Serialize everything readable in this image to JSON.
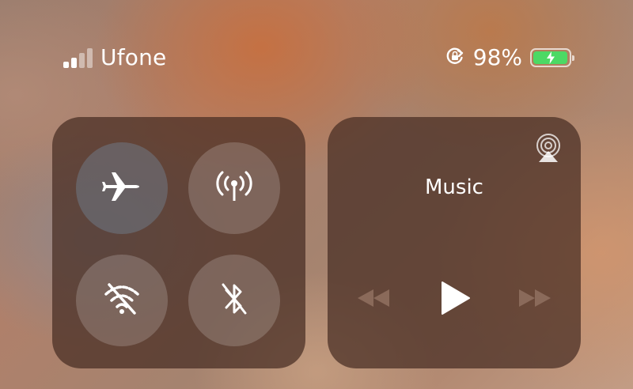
{
  "status_bar": {
    "carrier": "Ufone",
    "battery_percent": "98%",
    "battery_level": 0.98,
    "icons": [
      "signal-icon",
      "orientation-lock-icon",
      "battery-charging-icon"
    ]
  },
  "connectivity": {
    "toggles": [
      {
        "name": "airplane-mode",
        "icon": "airplane-icon",
        "state": "off"
      },
      {
        "name": "cellular-data",
        "icon": "antenna-icon",
        "state": "off"
      },
      {
        "name": "wifi",
        "icon": "wifi-off-icon",
        "state": "off"
      },
      {
        "name": "bluetooth",
        "icon": "bluetooth-off-icon",
        "state": "off"
      }
    ]
  },
  "media": {
    "title": "Music",
    "icons": [
      "airplay-icon",
      "rewind-icon",
      "play-icon",
      "fast-forward-icon"
    ]
  },
  "colors": {
    "panel": "#462d23",
    "battery_fill": "#4cd964",
    "controls_dim": "#8a6a5a"
  }
}
